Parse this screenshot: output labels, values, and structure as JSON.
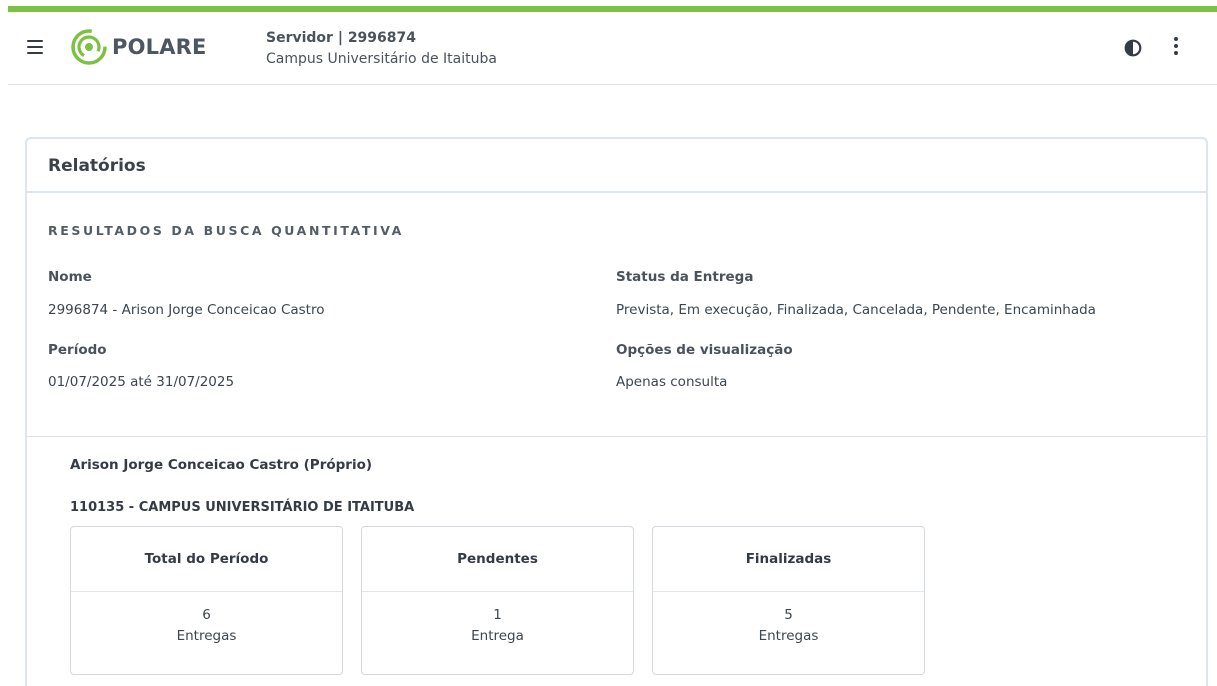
{
  "header": {
    "brand": "POLARE",
    "role": "Servidor |  2996874",
    "campus": "Campus Universitário de Itaituba",
    "icons": {
      "menu": "hamburger-menu-icon",
      "contrast": "contrast-icon",
      "more": "more-vertical-icon"
    },
    "accent_color": "#7cc242"
  },
  "report": {
    "title": "Relatórios",
    "section_title": "RESULTADOS DA BUSCA QUANTITATIVA",
    "fields": {
      "name_label": "Nome",
      "name_value": "2996874 - Arison Jorge Conceicao Castro",
      "status_label": "Status da Entrega",
      "status_value": "Prevista, Em execução, Finalizada, Cancelada, Pendente, Encaminhada",
      "period_label": "Período",
      "period_value": "01/07/2025 até 31/07/2025",
      "view_label": "Opções de visualização",
      "view_value": "Apenas consulta"
    },
    "person": "Arison Jorge Conceicao Castro (Próprio)",
    "unit": "110135 - CAMPUS UNIVERSITÁRIO DE ITAITUBA",
    "stats": [
      {
        "title": "Total do Período",
        "count": "6",
        "unit": "Entregas"
      },
      {
        "title": "Pendentes",
        "count": "1",
        "unit": "Entrega"
      },
      {
        "title": "Finalizadas",
        "count": "5",
        "unit": "Entregas"
      }
    ]
  }
}
